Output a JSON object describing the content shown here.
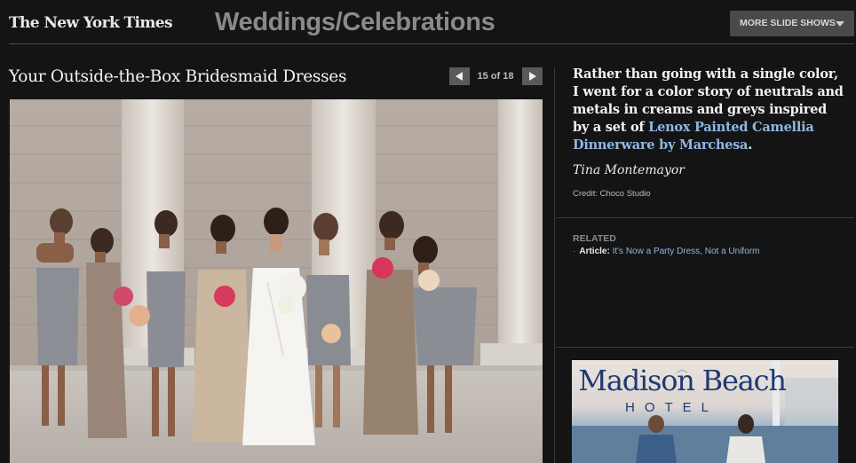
{
  "header": {
    "logo": "The New York Times",
    "section_title": "Weddings/Celebrations",
    "more_button": "MORE SLIDE SHOWS"
  },
  "slideshow": {
    "title": "Your Outside-the-Box Bridesmaid Dresses",
    "counter": "15 of 18",
    "photo_alt": "Bride laughing with seven bridesmaids in grey, silver and champagne dresses in front of stone columns"
  },
  "caption": {
    "text_before": "Rather than going with a single color, I went for a color story of neutrals and metals in creams and greys inspired by a set of ",
    "link_text": "Lenox Painted Camellia Dinnerware by Marchesa",
    "text_after": ".",
    "author": "Tina Montemayor",
    "credit": "Credit: Choco Studio"
  },
  "related": {
    "heading": "RELATED",
    "item_kind": "Article:",
    "item_link": "It's Now a Party Dress, Not a Uniform"
  },
  "ad": {
    "name": "Madison Beach",
    "sub": "HOTEL"
  },
  "colors": {
    "background": "#141414",
    "link": "#8fb7e3",
    "ad_navy": "#1f3a72"
  },
  "icons": [
    "chevron-left-icon",
    "chevron-right-icon",
    "caret-down-icon"
  ]
}
